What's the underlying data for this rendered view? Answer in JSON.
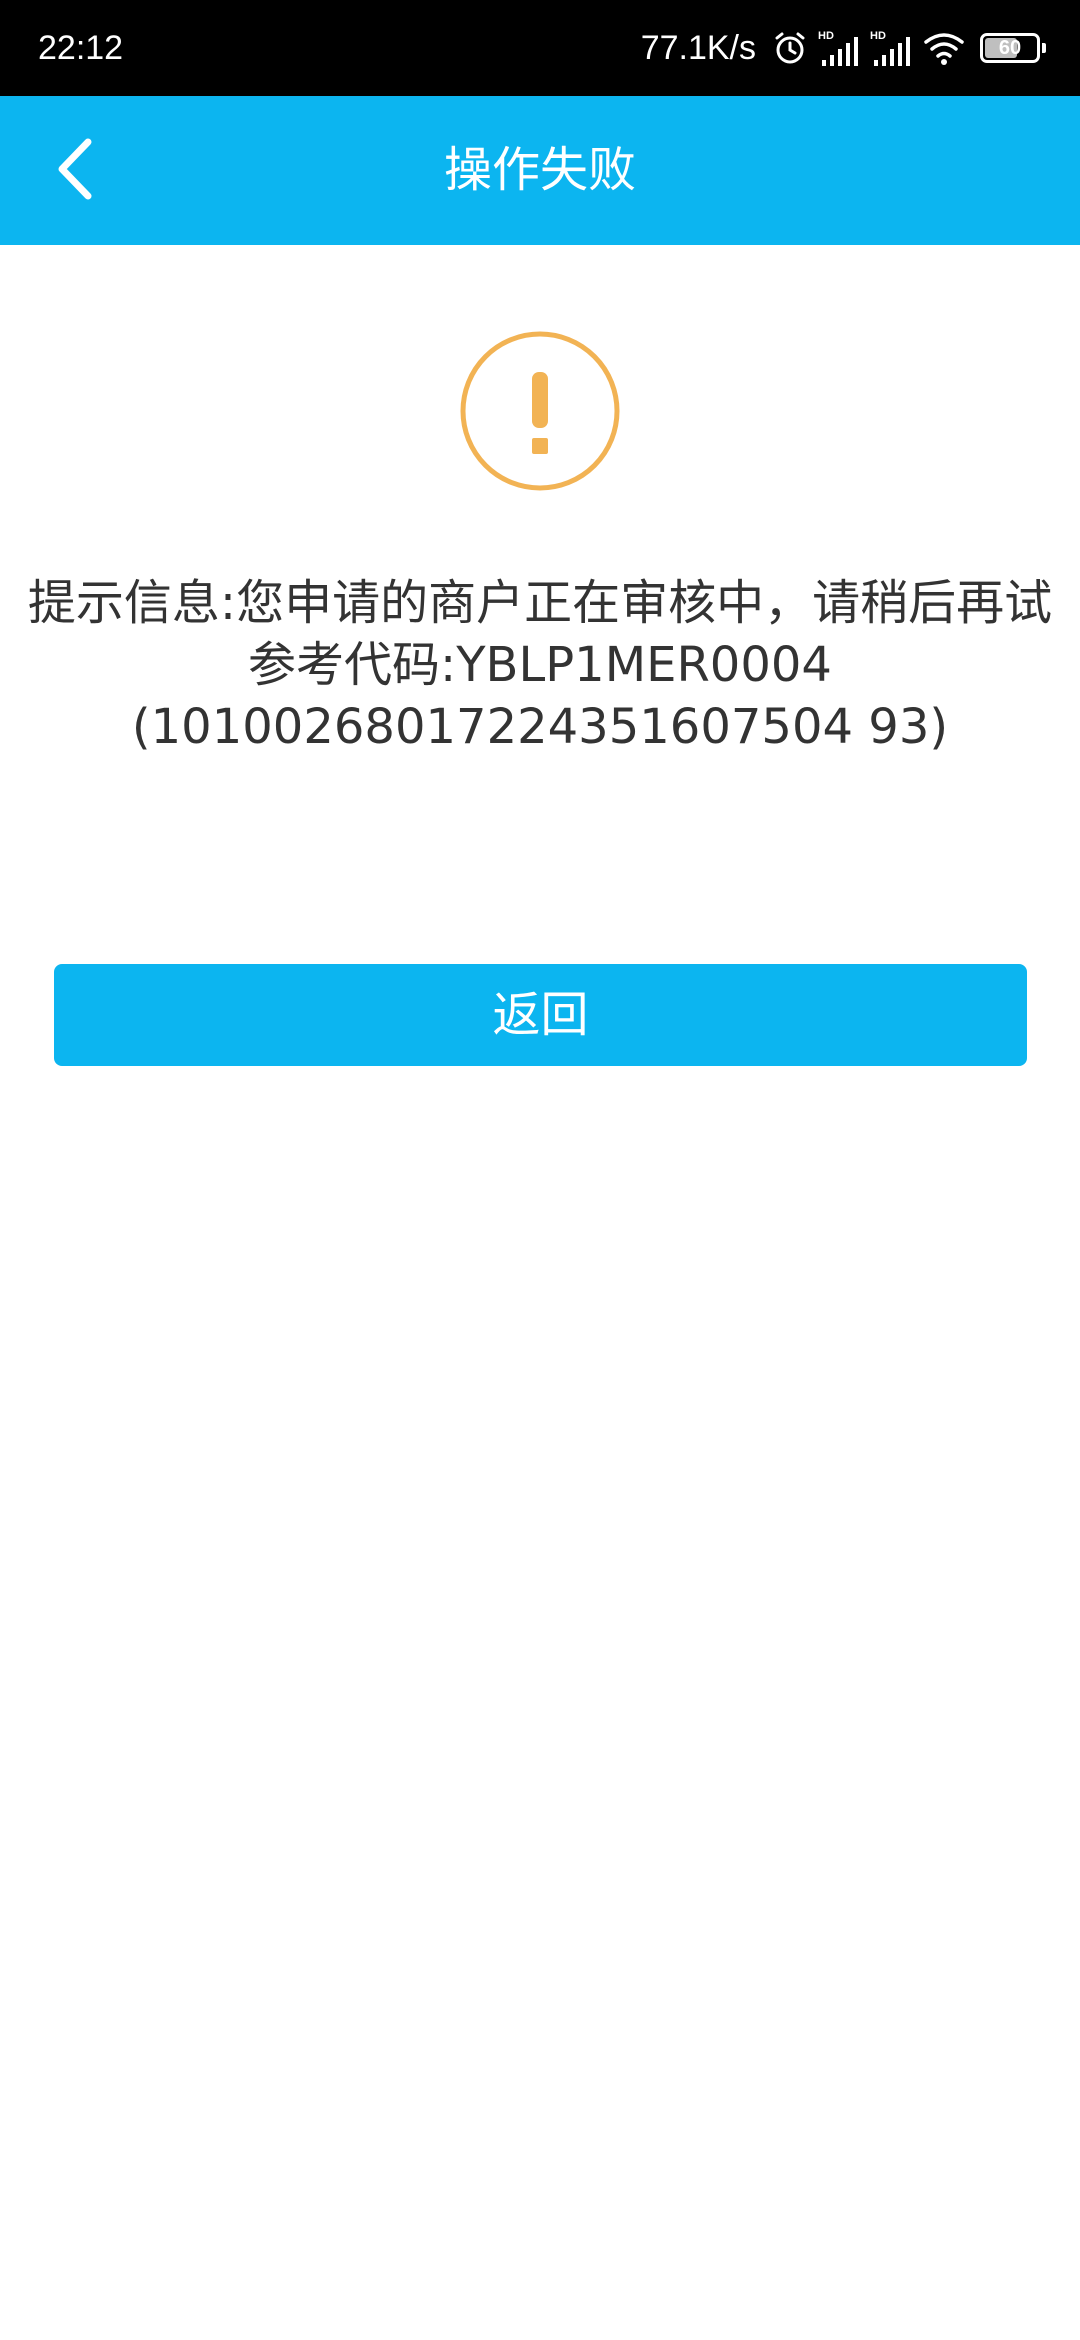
{
  "status_bar": {
    "time": "22:12",
    "net_speed": "77.1K/s",
    "battery_level": "60",
    "icons": [
      "alarm-icon",
      "hd-signal-icon",
      "hd-signal-icon",
      "wifi-icon",
      "battery-icon"
    ]
  },
  "nav": {
    "title": "操作失败",
    "back_icon": "chevron-left-icon"
  },
  "message": {
    "prompt": "提示信息:您申请的商户正在审核中，请稍后再试",
    "reference_label": "参考代码:YBLP1MER0004",
    "reference_number": "(10100268017224351607504 93)"
  },
  "actions": {
    "return_label": "返回"
  },
  "colors": {
    "accent": "#0cb5f0",
    "warning": "#f2b354",
    "text": "#333333"
  }
}
